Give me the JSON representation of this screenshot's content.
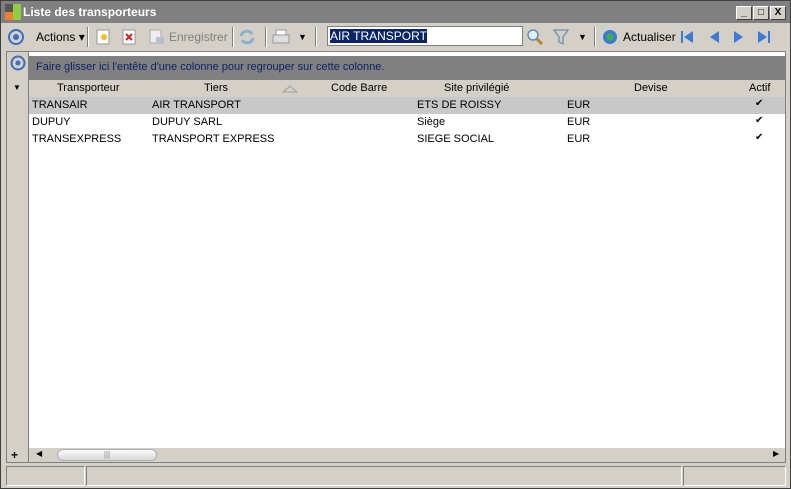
{
  "window": {
    "title": "Liste des transporteurs",
    "minimize": "_",
    "maximize": "□",
    "close": "X"
  },
  "toolbar": {
    "actions": "Actions",
    "save": "Enregistrer",
    "search_value": "AIR TRANSPORT",
    "refresh": "Actualiser"
  },
  "grid": {
    "group_hint": "Faire glisser ici l'entête d'une colonne pour regrouper sur cette colonne.",
    "columns": [
      "Transporteur",
      "Tiers",
      "Code Barre",
      "Site privilégié",
      "Devise",
      "Actif"
    ],
    "rows": [
      {
        "transporteur": "TRANSAIR",
        "tiers": "AIR TRANSPORT",
        "code_barre": "",
        "site": "ETS DE ROISSY",
        "devise": "EUR",
        "actif": true
      },
      {
        "transporteur": "DUPUY",
        "tiers": "DUPUY SARL",
        "code_barre": "",
        "site": "Siège",
        "devise": "EUR",
        "actif": true
      },
      {
        "transporteur": "TRANSEXPRESS",
        "tiers": "TRANSPORT EXPRESS",
        "code_barre": "",
        "site": "SIEGE SOCIAL",
        "devise": "EUR",
        "actif": true
      }
    ]
  },
  "colors": {
    "accent": "#0a246a",
    "nav": "#3a7bd5"
  }
}
